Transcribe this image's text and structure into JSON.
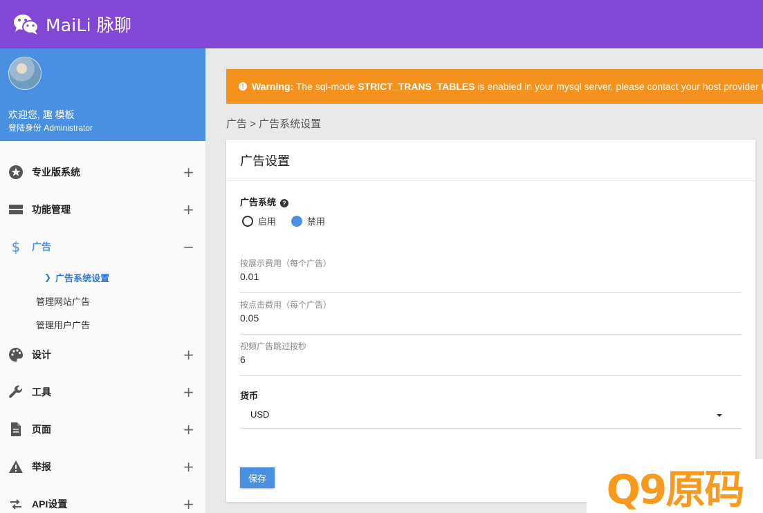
{
  "header": {
    "brand": "MaiLi 脉聊",
    "logo_icon": "wechat-icon",
    "bg_color": "#8347d5"
  },
  "sidebar": {
    "profile": {
      "welcome": "欢迎您, 趣 模板",
      "role": "登陆身份 Administrator",
      "bg_color": "#4a90e2"
    },
    "items": [
      {
        "label": "专业版系统",
        "icon": "star-circle-icon",
        "toggle": "+"
      },
      {
        "label": "功能管理",
        "icon": "layout-icon",
        "toggle": "+"
      },
      {
        "label": "广告",
        "icon": "dollar-icon",
        "toggle": "−",
        "active": true,
        "children": [
          "广告系统设置",
          "管理网站广告",
          "管理用户广告"
        ]
      },
      {
        "label": "设计",
        "icon": "palette-icon",
        "toggle": "+"
      },
      {
        "label": "工具",
        "icon": "wrench-icon",
        "toggle": "+"
      },
      {
        "label": "页面",
        "icon": "document-icon",
        "toggle": "+"
      },
      {
        "label": "举报",
        "icon": "warning-icon",
        "toggle": "+"
      },
      {
        "label": "API设置",
        "icon": "transfer-icon",
        "toggle": "+"
      }
    ]
  },
  "warning": {
    "prefix": "Warning:",
    "text1": " The sql-mode ",
    "code": "STRICT_TRANS_TABLES",
    "text2": " is enabled in your mysql server, please contact your host provider to di",
    "bg_color": "#f5921e"
  },
  "breadcrumb": "广告 > 广告系统设置",
  "card": {
    "title": "广告设置",
    "ad_system": {
      "label": "广告系统",
      "options": [
        "启用",
        "禁用"
      ],
      "selected": "禁用"
    },
    "fields": [
      {
        "label": "按展示费用（每个广告）",
        "value": "0.01"
      },
      {
        "label": "按点击费用（每个广告）",
        "value": "0.05"
      },
      {
        "label": "视频广告跳过按秒",
        "value": "6"
      }
    ],
    "currency": {
      "label": "货币",
      "value": "USD"
    },
    "save_label": "保存"
  },
  "watermark": "Q9原码"
}
